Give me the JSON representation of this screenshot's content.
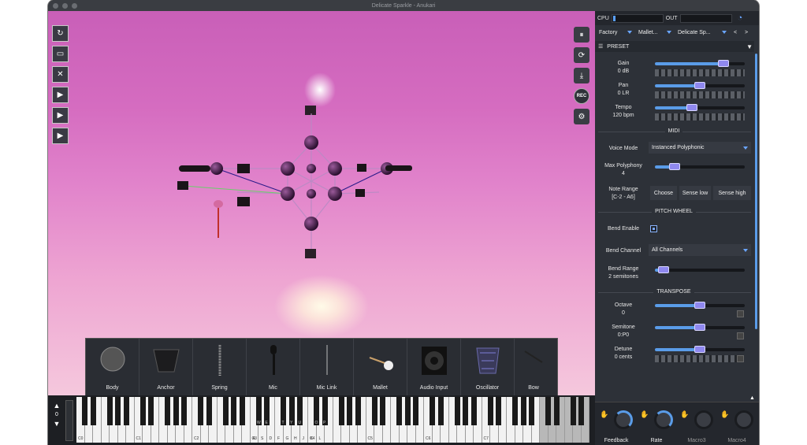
{
  "window": {
    "title": "Delicate Sparkle - Anukari"
  },
  "left_tools": [
    {
      "name": "select-tool",
      "glyph": "↻"
    },
    {
      "name": "screen-tool",
      "glyph": "▭"
    },
    {
      "name": "camera-off-tool",
      "glyph": "✕"
    },
    {
      "name": "camera-add-tool",
      "glyph": "▶"
    },
    {
      "name": "camera-move-tool",
      "glyph": "▶"
    },
    {
      "name": "camera-orbit-tool",
      "glyph": "▶"
    }
  ],
  "right_tools": {
    "pause": "⏸",
    "refresh": "⟳",
    "download": "⤓",
    "rec": "REC",
    "settings": "⚙"
  },
  "object_palette": [
    {
      "label": "Body"
    },
    {
      "label": "Anchor"
    },
    {
      "label": "Spring"
    },
    {
      "label": "Mic"
    },
    {
      "label": "Mic Link"
    },
    {
      "label": "Mallet"
    },
    {
      "label": "Audio Input"
    },
    {
      "label": "Oscillator"
    },
    {
      "label": "Bow"
    }
  ],
  "piano": {
    "octave_value": "0",
    "octave_labels": [
      "C0",
      "C1",
      "C2",
      "C3",
      "C4",
      "C5",
      "C6",
      "C7"
    ],
    "key_letters": [
      "A",
      "S",
      "D",
      "F",
      "G",
      "H",
      "J",
      "K",
      "L"
    ],
    "upper_letters": [
      "W",
      "E",
      "T",
      "Y",
      "U",
      "O",
      "P"
    ]
  },
  "meters": {
    "cpu_label": "CPU",
    "out_label": "OUT"
  },
  "preset_bar": {
    "bank": "Factory",
    "category": "Mallet...",
    "preset": "Delicate Sp...",
    "prev": "<",
    "next": ">"
  },
  "preset_section": {
    "title": "PRESET"
  },
  "params": {
    "gain": {
      "label": "Gain",
      "value": "0 dB",
      "level": 0.8
    },
    "pan": {
      "label": "Pan",
      "value": "0 LR",
      "level": 0.5
    },
    "tempo": {
      "label": "Tempo",
      "value": "120 bpm",
      "level": 0.4
    }
  },
  "midi": {
    "title": "MIDI",
    "voice_mode_label": "Voice Mode",
    "voice_mode_value": "Instanced Polyphonic",
    "max_poly_label": "Max Polyphony",
    "max_poly_value": "4",
    "max_poly_level": 0.18,
    "note_range_label": "Note Range",
    "note_range_value": "[C-2 - A6]",
    "choose": "Choose",
    "sense_low": "Sense low",
    "sense_high": "Sense high"
  },
  "pitch_wheel": {
    "title": "PITCH WHEEL",
    "bend_enable_label": "Bend Enable",
    "bend_channel_label": "Bend Channel",
    "bend_channel_value": "All Channels",
    "bend_range_label": "Bend Range",
    "bend_range_value": "2 semitones",
    "bend_range_level": 0.04
  },
  "transpose": {
    "title": "TRANSPOSE",
    "octave": {
      "label": "Octave",
      "value": "0",
      "level": 0.5
    },
    "semitone": {
      "label": "Semitone",
      "value": "0:P0",
      "level": 0.5
    },
    "detune": {
      "label": "Detune",
      "value": "0 cents",
      "level": 0.5
    }
  },
  "macros": [
    {
      "label": "Feedback",
      "active": true
    },
    {
      "label": "Rate",
      "active": true
    },
    {
      "label": "Macro3",
      "active": false
    },
    {
      "label": "Macro4",
      "active": false
    }
  ],
  "colors": {
    "accent": "#5a9ce8",
    "knob": "#8f88ef",
    "panel": "#2d3138"
  }
}
